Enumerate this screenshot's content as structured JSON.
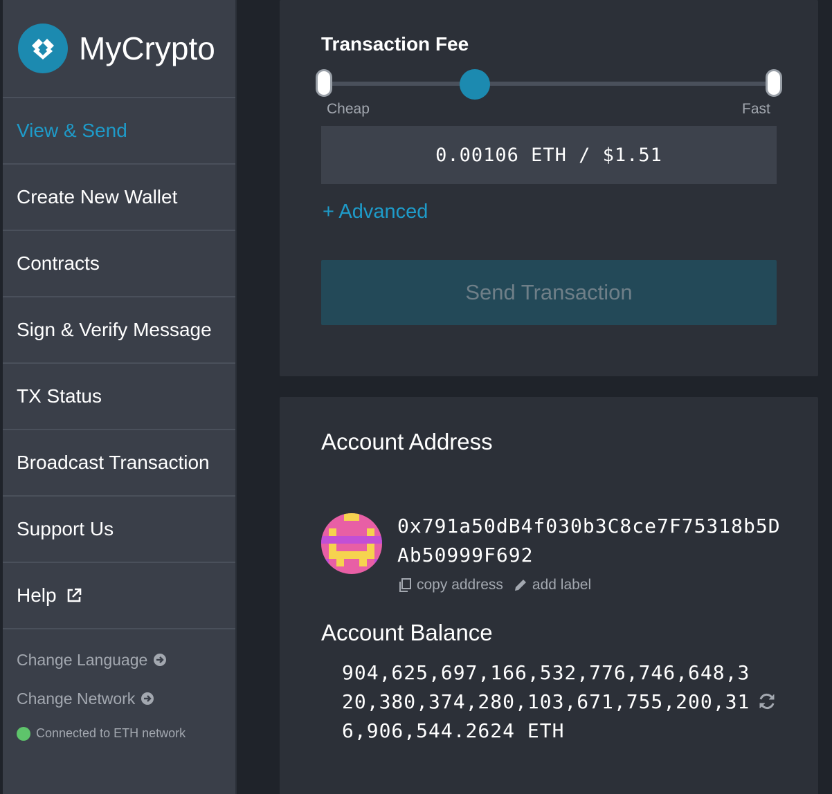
{
  "sidebar": {
    "logo_text": "MyCrypto",
    "nav": [
      {
        "label": "View & Send",
        "active": true
      },
      {
        "label": "Create New Wallet"
      },
      {
        "label": "Contracts"
      },
      {
        "label": "Sign & Verify Message"
      },
      {
        "label": "TX Status"
      },
      {
        "label": "Broadcast Transaction"
      },
      {
        "label": "Support Us"
      },
      {
        "label": "Help"
      }
    ],
    "change_language": "Change Language",
    "change_network": "Change Network",
    "network_status": "Connected to ETH network"
  },
  "fee": {
    "title": "Transaction Fee",
    "cheap_label": "Cheap",
    "fast_label": "Fast",
    "amount": "0.00106 ETH / $1.51",
    "slider_level": 0.32
  },
  "advanced_label": "+ Advanced",
  "send_button": "Send Transaction",
  "account": {
    "address_title": "Account Address",
    "address": "0x791a50dB4f030b3C8ce7F75318b5DAb50999F692",
    "copy_label": "copy address",
    "label_label": "add label",
    "balance_title": "Account Balance",
    "balance": "904,625,697,166,532,776,746,648,320,380,374,280,103,671,755,200,316,906,544.2624 ETH"
  },
  "colors": {
    "accent": "#1e9bc9",
    "status_green": "#5ec46b"
  }
}
